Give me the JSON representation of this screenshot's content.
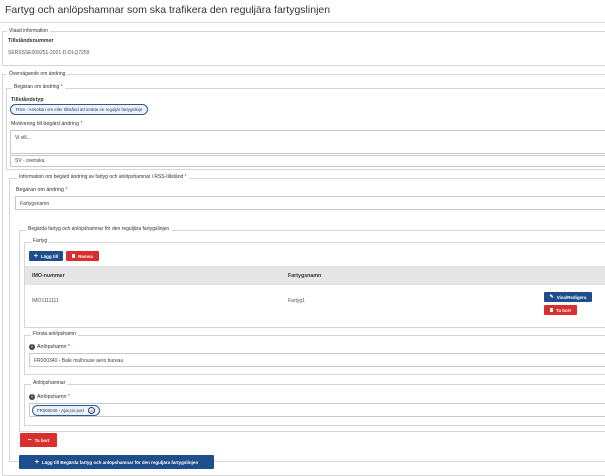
{
  "page": {
    "title": "Fartyg och anlöpshamnar som ska trafikera den reguljära fartygslinjen"
  },
  "vald_information": {
    "legend": "Vlaad information",
    "field_label": "Tillståndsnummer",
    "field_value": "SERSSSE009251-2021-D-DLQ7259"
  },
  "overvagande": {
    "legend": "Övervägande om ändring",
    "begaran_legend": "Begäran om ändring",
    "tillstandstyp_label": "Tillståndstyp",
    "tillstandstyp_value": "RSS - Ansökan om eller tillstånd att inrätta en reguljär fartygslinje",
    "motivering_label": "Motivering till begärd ändring",
    "motivering_value": "Vi vill...",
    "language_value": "SV - svenska"
  },
  "information_section": {
    "legend": "Information om begärd ändring av fartyg och anlöpshamnar i RSS-tillstånd",
    "begaran_label": "Begäran om ändring",
    "begaran_value": "Fartygsnamn",
    "begarda_legend": "Begärda fartyg och anlöpshamnar för den reguljära fartygslinjen",
    "fartyg_legend": "Fartyg",
    "add_button": "Lägg till",
    "remove_button": "Remsa",
    "table": {
      "columns": [
        "IMO-nummer",
        "Fartygsnamn"
      ],
      "rows": [
        {
          "imo": "IMO1111111",
          "name": "Fartyg1"
        }
      ],
      "view_edit_button": "Visa/Redigera",
      "delete_button": "Ta bort"
    },
    "forsta_legend": "Första anlöpshamn",
    "forsta_label": "Anlöpshamn",
    "forsta_value": "FR000340 - Bale mulhouse aero bureau",
    "anlop_legend": "Anlöpshamnar",
    "anlop_label": "Anlöpshamn",
    "anlop_tag": "FR000040 - Ajaccio port",
    "ta_bort_button": "Ta bort",
    "add_begarda_button": "Lägg till Begärda fartyg och anlöpshamnar för den reguljära fartygslinjen"
  },
  "colors": {
    "primary": "#1f4e8c",
    "danger": "#d9302f",
    "required": "#c9302c"
  }
}
